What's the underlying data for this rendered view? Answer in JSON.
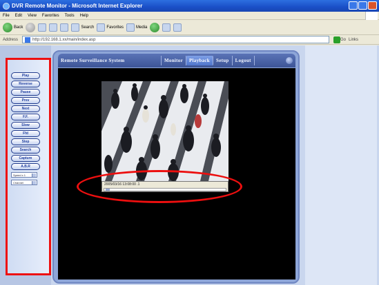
{
  "browser": {
    "title": "DVR Remote Monitor - Microsoft Internet Explorer",
    "menu": [
      "File",
      "Edit",
      "View",
      "Favorites",
      "Tools",
      "Help"
    ],
    "toolbar": {
      "back": "Back",
      "search": "Search",
      "favorites": "Favorites",
      "media": "Media"
    },
    "address_label": "Address",
    "address": "http://192.168.1.xx/main/index.asp",
    "go": "Go",
    "links": "Links"
  },
  "app": {
    "nav": {
      "system": "Remote Surveillance System",
      "monitor": "Monitor",
      "playback": "Playback",
      "setup": "Setup",
      "logout": "Logout",
      "active": "Playback"
    },
    "controls": [
      "Play",
      "Reverse",
      "Pause",
      "Prev",
      "Next",
      "F.F.",
      "Slow",
      "Ffd",
      "Step",
      "Search",
      "Capture",
      "A.B.R"
    ],
    "selects": {
      "speed": "Speed x 1",
      "channel": "Channel"
    },
    "playback": {
      "timestamp": "2005/03/16    13:08:00 .1"
    }
  },
  "colors": {
    "highlight": "#ec0f0f",
    "nav": "#3d5597",
    "viewer_bg": "#000000"
  }
}
